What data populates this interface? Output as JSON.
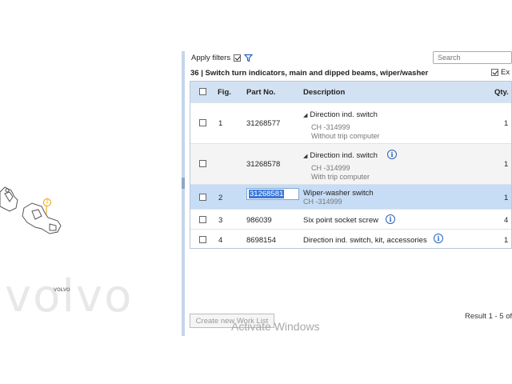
{
  "left_panel": {
    "callout_number": "2",
    "watermark": "volvo",
    "logo_text": "VOLVO"
  },
  "toolbar": {
    "apply_filters_label": "Apply filters",
    "apply_filters_checked": true,
    "search_placeholder": "Search"
  },
  "section": {
    "title": "36  |  Switch turn indicators, main and dipped beams, wiper/washer",
    "expand_label": "Ex",
    "expand_checked": true
  },
  "table": {
    "headers": {
      "fig": "Fig.",
      "part_no": "Part No.",
      "description": "Description",
      "qty": "Qty."
    },
    "rows": [
      {
        "fig": "1",
        "part_no": "31268577",
        "description": "Direction ind. switch",
        "sub1": "CH -314999",
        "sub2": "Without trip computer",
        "qty": "1",
        "info": false,
        "expandable": true
      },
      {
        "fig": "",
        "part_no": "31268578",
        "description": "Direction ind. switch",
        "sub1": "CH -314999",
        "sub2": "With trip computer",
        "qty": "1",
        "info": true,
        "expandable": true
      },
      {
        "fig": "2",
        "part_no": "31268581",
        "description": "Wiper-washer switch",
        "sub1": "CH -314999",
        "sub2": "",
        "qty": "1",
        "info": false,
        "expandable": false,
        "selected": true
      },
      {
        "fig": "3",
        "part_no": "986039",
        "description": "Six point socket screw",
        "sub1": "",
        "sub2": "",
        "qty": "4",
        "info": true,
        "expandable": false
      },
      {
        "fig": "4",
        "part_no": "8698154",
        "description": "Direction ind. switch, kit, accessories",
        "sub1": "",
        "sub2": "",
        "qty": "1",
        "info": true,
        "expandable": false
      }
    ]
  },
  "footer": {
    "create_button_label": "Create new Work List",
    "result_text": "Result 1 - 5 of",
    "activate_text": "Activate Windows"
  },
  "icons": {
    "filter": "filter-icon",
    "info": "info-icon",
    "expand_triangle": "expand-triangle-icon"
  },
  "colors": {
    "header_bg": "#d3e2f3",
    "selected_row_bg": "#c7dcf5",
    "info_blue": "#2a62b8",
    "divider": "#c5d6ea"
  }
}
